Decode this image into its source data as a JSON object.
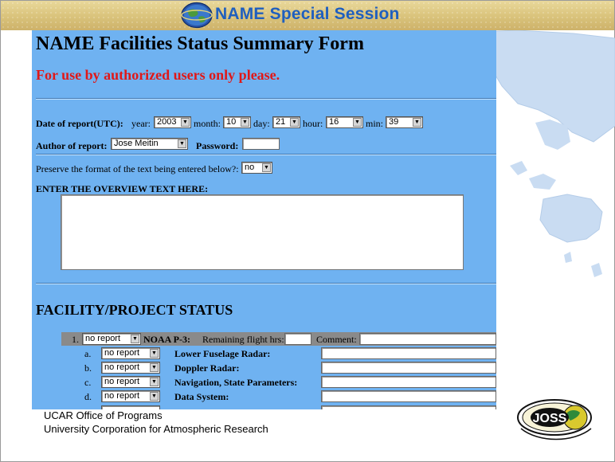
{
  "banner": {
    "title": "NAME Special Session"
  },
  "form": {
    "title": "NAME Facilities Status Summary Form",
    "subtitle": "For use by authorized users only please.",
    "date_label": "Date of report(UTC):",
    "year_label": "year:",
    "year": "2003",
    "month_label": "month:",
    "month": "10",
    "day_label": "day:",
    "day": "21",
    "hour_label": "hour:",
    "hour": "16",
    "min_label": "min:",
    "min": "39",
    "author_label": "Author of report:",
    "author": "Jose Meitin",
    "password_label": "Password:",
    "preserve_label": "Preserve the format of the text being entered below?:",
    "preserve_value": "no",
    "overview_label": "ENTER THE OVERVIEW TEXT HERE:",
    "overview_text": ""
  },
  "facility": {
    "section_title": "FACILITY/PROJECT STATUS",
    "row1": {
      "num": "1.",
      "status": "no report",
      "name": "NOAA P-3:",
      "remaining_label": "Remaining flight hrs:",
      "comment_label": "Comment:"
    },
    "subitems": [
      {
        "letter": "a.",
        "status": "no report",
        "label": "Lower Fuselage Radar:"
      },
      {
        "letter": "b.",
        "status": "no report",
        "label": "Doppler Radar:"
      },
      {
        "letter": "c.",
        "status": "no report",
        "label": "Navigation, State Parameters:"
      },
      {
        "letter": "d.",
        "status": "no report",
        "label": "Data System:"
      }
    ]
  },
  "footer": {
    "line1": "UCAR Office of Programs",
    "line2": "University Corporation for Atmospheric Research"
  },
  "logo": {
    "joss_text": "JOSS"
  },
  "colors": {
    "panel": "#6fb2f1",
    "banner_title": "#1f5fbf",
    "subtitle": "#e01818",
    "ocean": "#ffffff",
    "land": "#c9dcf2"
  }
}
